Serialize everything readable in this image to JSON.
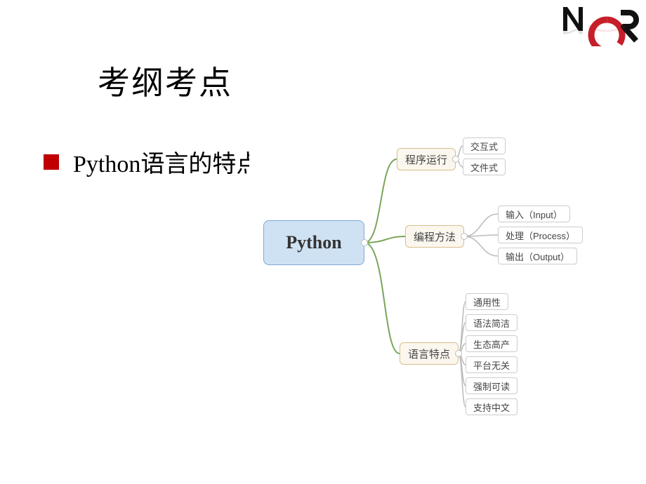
{
  "title": "考纲考点",
  "bullet": "Python语言的特点",
  "mindmap": {
    "root": "Python",
    "branches": [
      {
        "label": "程序运行",
        "leaves": [
          "交互式",
          "文件式"
        ]
      },
      {
        "label": "编程方法",
        "leaves": [
          "输入（Input）",
          "处理（Process）",
          "输出（Output）"
        ]
      },
      {
        "label": "语言特点",
        "leaves": [
          "通用性",
          "语法简洁",
          "生态高产",
          "平台无关",
          "强制可读",
          "支持中文"
        ]
      }
    ]
  },
  "logo_alt": "NCR"
}
